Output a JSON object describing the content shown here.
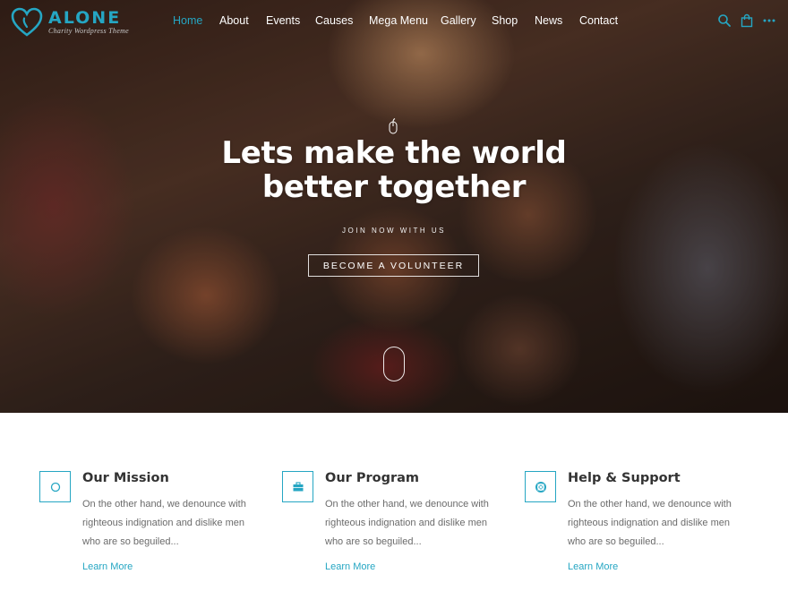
{
  "brand": {
    "name": "ALONE",
    "tagline": "Charity Wordpress Theme",
    "accent_color": "#25a6c3"
  },
  "nav": {
    "items": [
      {
        "label": "Home",
        "active": true
      },
      {
        "label": "About",
        "active": false
      },
      {
        "label": "Events",
        "active": false
      },
      {
        "label": "Causes",
        "active": false
      },
      {
        "label": "Mega Menu",
        "active": false
      },
      {
        "label": "Gallery",
        "active": false
      },
      {
        "label": "Shop",
        "active": false
      },
      {
        "label": "News",
        "active": false
      },
      {
        "label": "Contact",
        "active": false
      }
    ],
    "icons": [
      "search-icon",
      "shopping-bag-icon",
      "more-dots-icon"
    ]
  },
  "hero": {
    "title_line1": "Lets make the world",
    "title_line2": "better together",
    "subtitle": "JOIN NOW WITH US",
    "button_label": "BECOME A VOLUNTEER",
    "icons": [
      "mouse-icon",
      "scroll-mouse-icon"
    ]
  },
  "features": [
    {
      "icon": "circle-icon",
      "title": "Our Mission",
      "description": "On the other hand, we denounce with righteous indignation and dislike men who are so beguiled...",
      "link": "Learn More"
    },
    {
      "icon": "briefcase-icon",
      "title": "Our Program",
      "description": "On the other hand, we denounce with righteous indignation and dislike men who are so beguiled...",
      "link": "Learn More"
    },
    {
      "icon": "lifebuoy-icon",
      "title": "Help & Support",
      "description": "On the other hand, we denounce with righteous indignation and dislike men who are so beguiled...",
      "link": "Learn More"
    }
  ]
}
